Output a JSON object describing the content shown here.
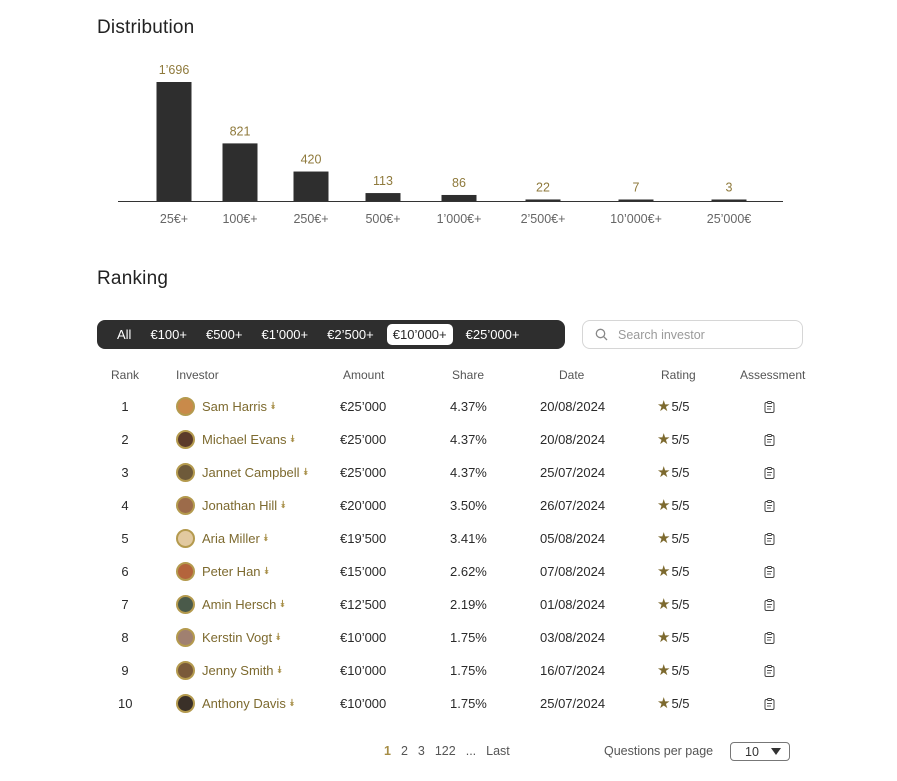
{
  "distribution": {
    "title": "Distribution"
  },
  "chart_data": {
    "type": "bar",
    "categories": [
      "25€+",
      "100€+",
      "250€+",
      "500€+",
      "1’000€+",
      "2’500€+",
      "10’000€+",
      "25’000€"
    ],
    "values": [
      1696,
      821,
      420,
      113,
      86,
      22,
      7,
      3
    ],
    "value_labels": [
      "1’696",
      "821",
      "420",
      "113",
      "86",
      "22",
      "7",
      "3"
    ],
    "title": "",
    "xlabel": "",
    "ylabel": "",
    "colors": {
      "bar": "#2e2e2e",
      "label": "#8f7a3c"
    }
  },
  "ranking": {
    "title": "Ranking",
    "filters": [
      "All",
      "€100+",
      "€500+",
      "€1’000+",
      "€2’500+",
      "€10’000+",
      "€25’000+"
    ],
    "active_filter": "€10’000+",
    "search": {
      "placeholder": "Search investor",
      "icon": "search-icon"
    },
    "columns": {
      "rank": "Rank",
      "investor": "Investor",
      "amount": "Amount",
      "share": "Share",
      "date": "Date",
      "rating": "Rating",
      "assessment": "Assessment"
    },
    "rows": [
      {
        "rank": "1",
        "name": "Sam Harris",
        "amount": "€25’000",
        "share": "4.37%",
        "date": "20/08/2024",
        "rating": "5/5",
        "avatar_color": "#c98a4a"
      },
      {
        "rank": "2",
        "name": "Michael Evans",
        "amount": "€25’000",
        "share": "4.37%",
        "date": "20/08/2024",
        "rating": "5/5",
        "avatar_color": "#5b3a2a"
      },
      {
        "rank": "3",
        "name": "Jannet Campbell",
        "amount": "€25’000",
        "share": "4.37%",
        "date": "25/07/2024",
        "rating": "5/5",
        "avatar_color": "#6e5a3a"
      },
      {
        "rank": "4",
        "name": "Jonathan Hill",
        "amount": "€20’000",
        "share": "3.50%",
        "date": "26/07/2024",
        "rating": "5/5",
        "avatar_color": "#9c6b4a"
      },
      {
        "rank": "5",
        "name": "Aria Miller",
        "amount": "€19’500",
        "share": "3.41%",
        "date": "05/08/2024",
        "rating": "5/5",
        "avatar_color": "#e2c9a0"
      },
      {
        "rank": "6",
        "name": "Peter Han",
        "amount": "€15’000",
        "share": "2.62%",
        "date": "07/08/2024",
        "rating": "5/5",
        "avatar_color": "#b4643c"
      },
      {
        "rank": "7",
        "name": "Amin Hersch",
        "amount": "€12’500",
        "share": "2.19%",
        "date": "01/08/2024",
        "rating": "5/5",
        "avatar_color": "#4a5a4a"
      },
      {
        "rank": "8",
        "name": "Kerstin Vogt",
        "amount": "€10’000",
        "share": "1.75%",
        "date": "03/08/2024",
        "rating": "5/5",
        "avatar_color": "#a08070"
      },
      {
        "rank": "9",
        "name": "Jenny Smith",
        "amount": "€10’000",
        "share": "1.75%",
        "date": "16/07/2024",
        "rating": "5/5",
        "avatar_color": "#7a5a3a"
      },
      {
        "rank": "10",
        "name": "Anthony Davis",
        "amount": "€10’000",
        "share": "1.75%",
        "date": "25/07/2024",
        "rating": "5/5",
        "avatar_color": "#3a3028"
      }
    ]
  },
  "pagination": {
    "pages": [
      "1",
      "2",
      "3",
      "122",
      "...",
      "Last"
    ],
    "active_page": "1",
    "per_page_label": "Questions per page",
    "per_page_value": "10"
  },
  "theme": {
    "accent": "#a68d45",
    "dark": "#2e2e2e"
  }
}
